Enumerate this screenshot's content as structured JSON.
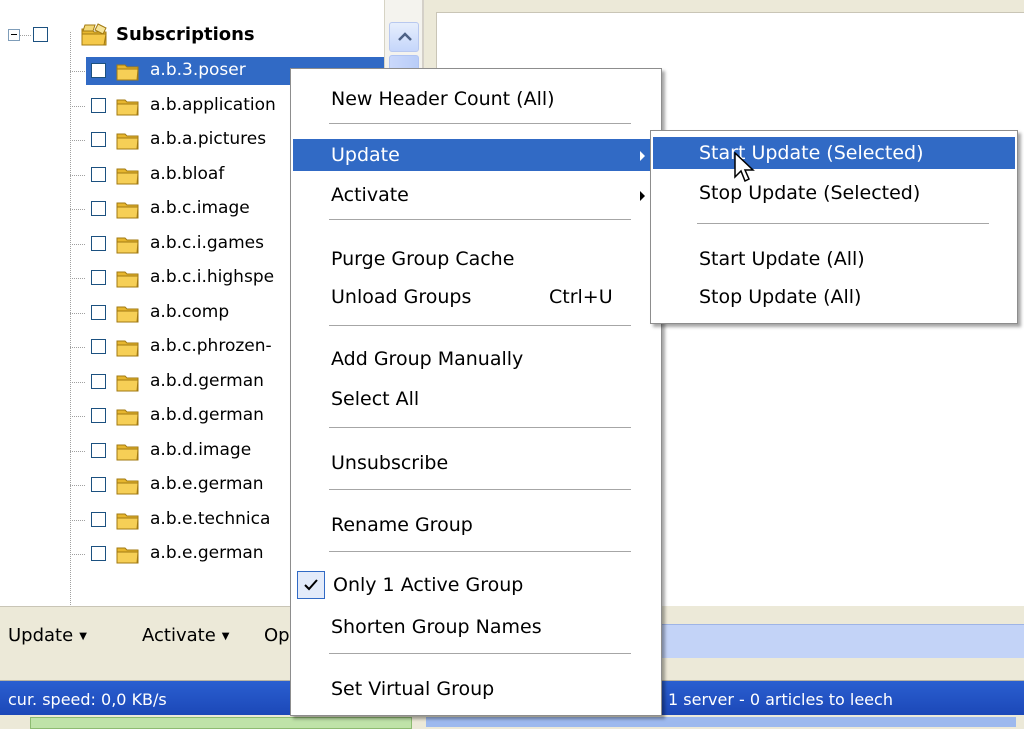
{
  "tree": {
    "root_label": "Subscriptions",
    "items": [
      "a.b.3.poser",
      "a.b.application",
      "a.b.a.pictures",
      "a.b.bloaf",
      "a.b.c.image",
      "a.b.c.i.games",
      "a.b.c.i.highspe",
      "a.b.comp",
      "a.b.c.phrozen-",
      "a.b.d.german",
      "a.b.d.german",
      "a.b.d.image",
      "a.b.e.german",
      "a.b.e.technica",
      "a.b.e.german"
    ],
    "selected_index": 0
  },
  "toolbar": {
    "update_label": "Update",
    "activate_label": "Activate",
    "options_label": "Op"
  },
  "context_menu": {
    "new_header_count": "New Header Count (All)",
    "update": "Update",
    "activate": "Activate",
    "purge_group_cache": "Purge Group Cache",
    "unload_groups": "Unload Groups",
    "unload_groups_shortcut": "Ctrl+U",
    "add_group_manually": "Add Group Manually",
    "select_all": "Select All",
    "unsubscribe": "Unsubscribe",
    "rename_group": "Rename Group",
    "only_one_active_group": "Only 1 Active Group",
    "shorten_group_names": "Shorten Group Names",
    "set_virtual_group": "Set Virtual Group"
  },
  "submenu": {
    "start_update_selected": "Start Update (Selected)",
    "stop_update_selected": "Stop Update (Selected)",
    "start_update_all": "Start Update (All)",
    "stop_update_all": "Stop Update (All)"
  },
  "status": {
    "speed": "cur. speed: 0,0 KB/s",
    "servers": "1 server  -  0 articles to leech"
  },
  "colors": {
    "selection": "#316ac5",
    "status_bar": "#2459c7",
    "window_bg": "#ece9d8"
  }
}
